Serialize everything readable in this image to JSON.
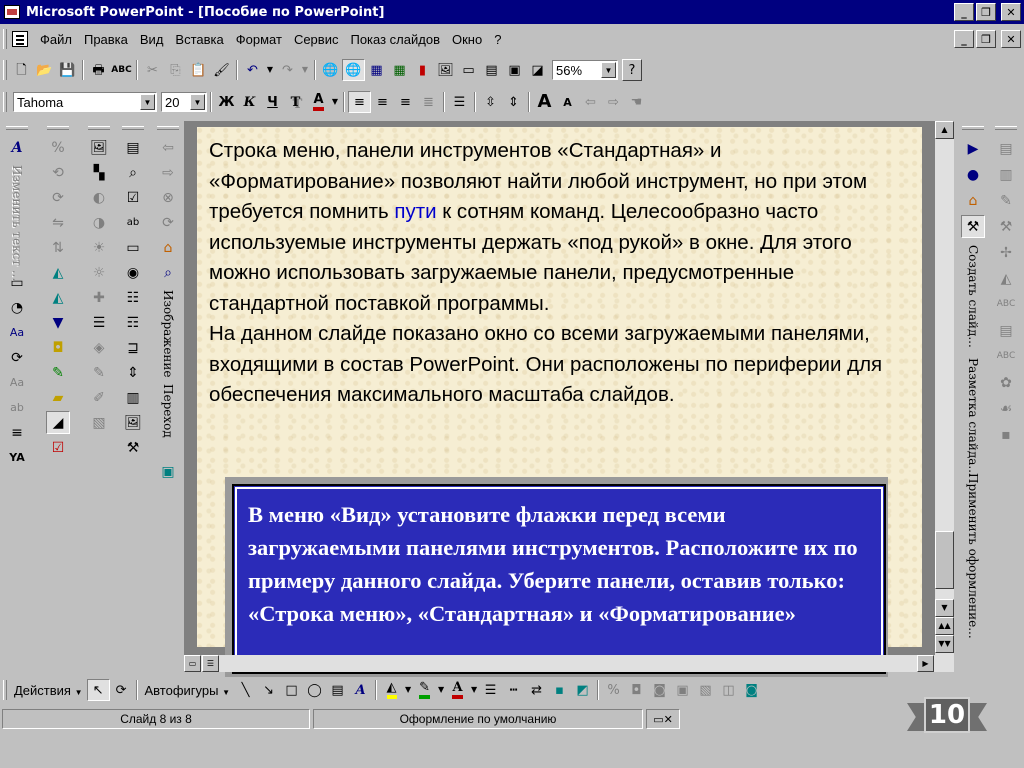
{
  "window": {
    "title": "Microsoft PowerPoint - [Пособие по PowerPoint]",
    "minimize_label": "_",
    "restore_label": "❐",
    "close_label": "✕"
  },
  "menubar": {
    "items": [
      {
        "label": "Файл"
      },
      {
        "label": "Правка"
      },
      {
        "label": "Вид"
      },
      {
        "label": "Вставка"
      },
      {
        "label": "Формат"
      },
      {
        "label": "Сервис"
      },
      {
        "label": "Показ слайдов"
      },
      {
        "label": "Окно"
      },
      {
        "label": "?"
      }
    ]
  },
  "standard_toolbar": {
    "zoom_value": "56%"
  },
  "formatting_toolbar": {
    "font_name": "Tahoma",
    "font_size": "20",
    "bold_label": "Ж",
    "italic_label": "К",
    "underline_label": "Ч",
    "shadow_label": "Т",
    "font_color_label": "А",
    "grow_font_label": "А",
    "shrink_font_label": "А"
  },
  "left_panels": {
    "outline_caption": "Изменить текст ...",
    "images_caption": "Изображение",
    "transition_caption": "Переход",
    "wordart_label": "A"
  },
  "right_panels": {
    "create_slide_caption": "Создать слайд...",
    "layout_caption": "Разметка слайда...",
    "design_caption": "Применить оформление..."
  },
  "slide": {
    "paragraph1_part1": "Строка меню, панели инструментов «Стандартная» и «Форматирование» позволяют найти любой инструмент, но при этом требуется помнить ",
    "paragraph1_link": "пути",
    "paragraph1_part2": " к сотням команд. Целесообразно часто используемые инструменты держать «под рукой» в окне. Для этого можно использовать загружаемые панели, предусмотренные стандартной поставкой программы.",
    "paragraph2": "На данном слайде показано окно со всеми загружаемыми панелями, входящими в состав PowerPoint. Они   расположены  по периферии для обеспечения  максимального масштаба слайдов.",
    "callout": "В меню «Вид» установите флажки перед всеми загружаемыми панелями инструментов. Расположите их по примеру данного слайда. Уберите панели, оставив только:  «Строка меню», «Стандартная» и «Форматирование»"
  },
  "drawing_toolbar": {
    "actions_label": "Действия",
    "autoshapes_label": "Автофигуры"
  },
  "statusbar": {
    "slide_counter": "Слайд 8 из 8",
    "design_name": "Оформление по умолчанию"
  },
  "badge": {
    "page_number": "10"
  },
  "colors": {
    "titlebar": "#000080",
    "callout_bg": "#2b2bb8",
    "link": "#0000cc",
    "slide_bg": "#f6eed3",
    "font_color_underline": "#c00000",
    "fill_color_underline": "#ffff00",
    "line_color_underline": "#00a000"
  }
}
